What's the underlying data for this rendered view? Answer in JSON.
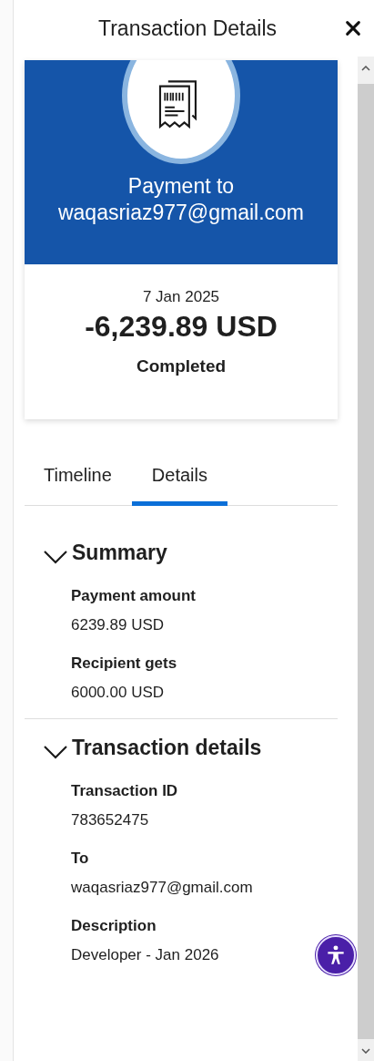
{
  "header": {
    "title": "Transaction Details"
  },
  "summary_card": {
    "heading": "Payment to",
    "recipient": "waqasriaz977@gmail.com",
    "date": "7 Jan 2025",
    "amount": "-6,239.89 USD",
    "status": "Completed"
  },
  "tabs": [
    {
      "label": "Timeline",
      "selected": false
    },
    {
      "label": "Details",
      "selected": true
    }
  ],
  "sections": [
    {
      "title": "Summary",
      "expanded": true,
      "fields": [
        {
          "label": "Payment amount",
          "value": "6239.89 USD"
        },
        {
          "label": "Recipient gets",
          "value": "6000.00 USD"
        }
      ]
    },
    {
      "title": "Transaction details",
      "expanded": true,
      "fields": [
        {
          "label": "Transaction ID",
          "value": "783652475"
        },
        {
          "label": "To",
          "value": "waqasriaz977@gmail.com"
        },
        {
          "label": "Description",
          "value": "Developer - Jan 2026"
        }
      ]
    }
  ]
}
